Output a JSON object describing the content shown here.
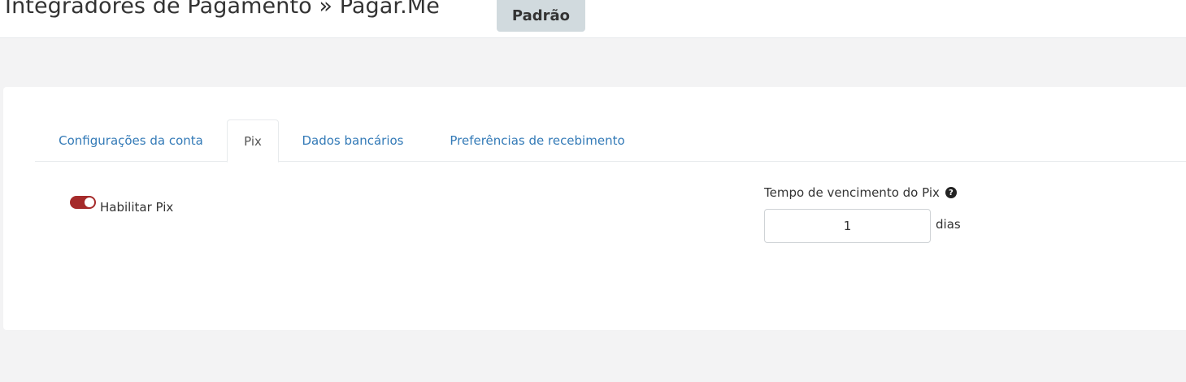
{
  "header": {
    "title": "Integradores de Pagamento » Pagar.Me",
    "badge": "Padrão"
  },
  "tabs": [
    {
      "label": "Configurações da conta",
      "active": false
    },
    {
      "label": "Pix",
      "active": true
    },
    {
      "label": "Dados bancários",
      "active": false
    },
    {
      "label": "Preferências de recebimento",
      "active": false
    }
  ],
  "pix": {
    "enable_label": "Habilitar Pix",
    "enabled": true,
    "toggle_color": "#a52a2a",
    "expiry_label": "Tempo de vencimento do Pix",
    "help_icon": "question-circle-icon",
    "expiry_value": "1",
    "expiry_unit": "dias"
  },
  "colors": {
    "link": "#337ab7",
    "background": "#f3f3f4",
    "badge_bg": "#d1dade"
  }
}
